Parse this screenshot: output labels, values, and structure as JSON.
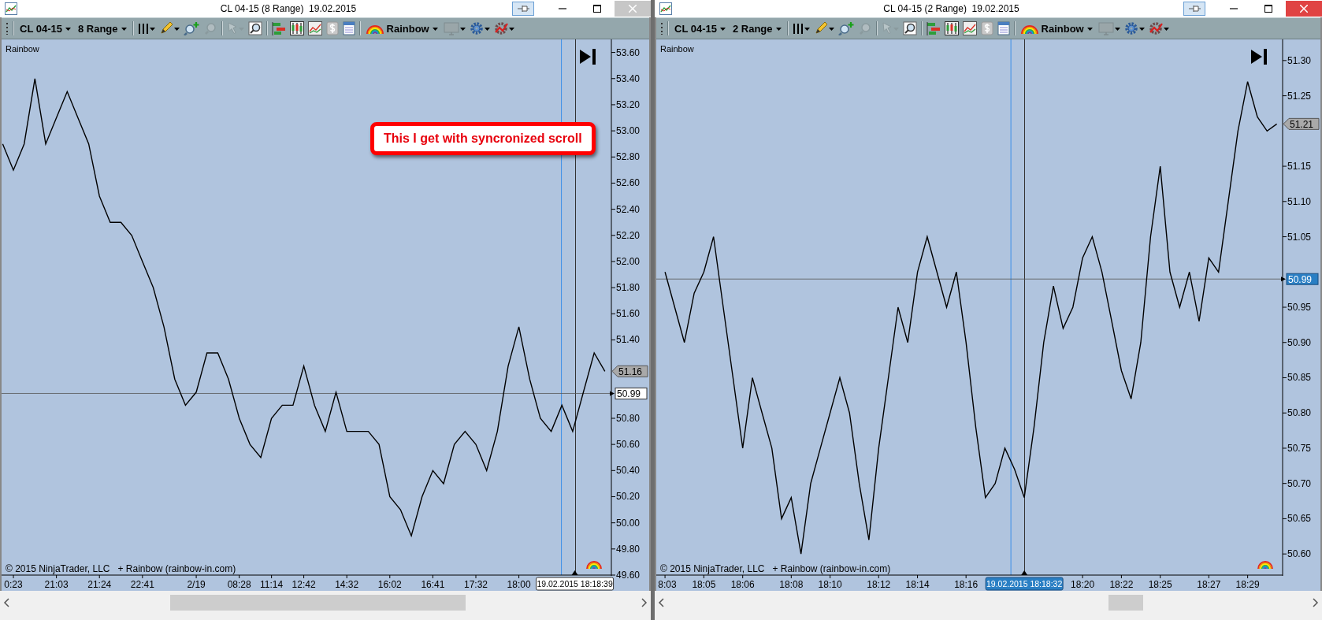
{
  "windows": [
    {
      "title": "CL 04-15 (8 Range)  19.02.2015",
      "close_highlighted": false,
      "toolbar": {
        "instrument": "CL 04-15",
        "period": "8 Range",
        "indicator": "Rainbow"
      },
      "chart": {
        "label": "Rainbow",
        "copyright": "© 2015 NinjaTrader, LLC   + Rainbow (rainbow-in.com)",
        "last_price": "51.16",
        "crosshair_price": "50.99",
        "cursor_time": "19.02.2015 18:18:39",
        "cursor_highlighted": false,
        "chart_data": {
          "type": "line",
          "ylim": [
            49.6,
            53.7
          ],
          "ref_lines": [
            {
              "axis": "y",
              "value": 50.99
            }
          ],
          "categories": [
            null,
            "0:23",
            null,
            null,
            null,
            "21:03",
            null,
            null,
            null,
            "21:24",
            null,
            null,
            null,
            "22:41",
            null,
            null,
            null,
            null,
            "2/19",
            null,
            null,
            null,
            "08:28",
            null,
            null,
            "11:14",
            null,
            null,
            "12:42",
            null,
            null,
            null,
            "14:32",
            null,
            null,
            null,
            "16:02",
            null,
            null,
            null,
            "16:41",
            null,
            null,
            null,
            "17:32",
            null,
            null,
            null,
            "18:00",
            null,
            null,
            null,
            null,
            null,
            null,
            null,
            null
          ],
          "yticks": [
            {
              "value": 53.6,
              "label": "53.60"
            },
            {
              "value": 53.4,
              "label": "53.40"
            },
            {
              "value": 53.2,
              "label": "53.20"
            },
            {
              "value": 53.0,
              "label": "53.00"
            },
            {
              "value": 52.8,
              "label": "52.80"
            },
            {
              "value": 52.6,
              "label": "52.60"
            },
            {
              "value": 52.4,
              "label": "52.40"
            },
            {
              "value": 52.2,
              "label": "52.20"
            },
            {
              "value": 52.0,
              "label": "52.00"
            },
            {
              "value": 51.8,
              "label": "51.80"
            },
            {
              "value": 51.6,
              "label": "51.60"
            },
            {
              "value": 51.4,
              "label": "51.40"
            },
            {
              "value": 50.8,
              "label": "50.80"
            },
            {
              "value": 50.6,
              "label": "50.60"
            },
            {
              "value": 50.4,
              "label": "50.40"
            },
            {
              "value": 50.2,
              "label": "50.20"
            },
            {
              "value": 50.0,
              "label": "50.00"
            },
            {
              "value": 49.8,
              "label": "49.80"
            },
            {
              "value": 49.6,
              "label": "49.60"
            }
          ],
          "series": [
            {
              "color": "#000000",
              "values": [
                52.9,
                52.7,
                52.9,
                53.4,
                52.9,
                53.1,
                53.3,
                53.1,
                52.9,
                52.5,
                52.3,
                52.3,
                52.2,
                52.0,
                51.8,
                51.5,
                51.1,
                50.9,
                51.0,
                51.3,
                51.3,
                51.1,
                50.8,
                50.6,
                50.5,
                50.8,
                50.9,
                50.9,
                51.2,
                50.9,
                50.7,
                51.0,
                50.7,
                50.7,
                50.7,
                50.6,
                50.2,
                50.1,
                49.9,
                50.2,
                50.4,
                50.3,
                50.6,
                50.7,
                50.6,
                50.4,
                50.7,
                51.2,
                51.5,
                51.1,
                50.8,
                50.7,
                50.9,
                50.7,
                51.0,
                51.3,
                51.16
              ]
            }
          ]
        }
      },
      "callout": "This I get with syncronized scroll"
    },
    {
      "title": "CL 04-15 (2 Range)  19.02.2015",
      "close_highlighted": true,
      "toolbar": {
        "instrument": "CL 04-15",
        "period": "2 Range",
        "indicator": "Rainbow"
      },
      "chart": {
        "label": "Rainbow",
        "copyright": "© 2015 NinjaTrader, LLC   + Rainbow (rainbow-in.com)",
        "last_price": "51.21",
        "crosshair_price": "50.99",
        "cursor_time": "19.02.2015 18:18:32",
        "cursor_highlighted": true,
        "chart_data": {
          "type": "line",
          "ylim": [
            50.57,
            51.33
          ],
          "ref_lines": [
            {
              "axis": "y",
              "value": 50.99
            }
          ],
          "categories": [
            "8:03",
            null,
            null,
            null,
            "18:05",
            null,
            null,
            null,
            "18:06",
            null,
            null,
            null,
            null,
            "18:08",
            null,
            null,
            null,
            "18:10",
            null,
            null,
            null,
            null,
            "18:12",
            null,
            null,
            null,
            "18:14",
            null,
            null,
            null,
            null,
            "18:16",
            null,
            null,
            null,
            null,
            null,
            null,
            null,
            null,
            null,
            null,
            null,
            "18:20",
            null,
            null,
            null,
            "18:22",
            null,
            null,
            null,
            "18:25",
            null,
            null,
            null,
            null,
            "18:27",
            null,
            null,
            null,
            "18:29",
            null,
            null,
            null
          ],
          "yticks": [
            {
              "value": 51.3,
              "label": "51.30"
            },
            {
              "value": 51.25,
              "label": "51.25"
            },
            {
              "value": 51.15,
              "label": "51.15"
            },
            {
              "value": 51.1,
              "label": "51.10"
            },
            {
              "value": 51.05,
              "label": "51.05"
            },
            {
              "value": 50.95,
              "label": "50.95"
            },
            {
              "value": 50.9,
              "label": "50.90"
            },
            {
              "value": 50.85,
              "label": "50.85"
            },
            {
              "value": 50.8,
              "label": "50.80"
            },
            {
              "value": 50.75,
              "label": "50.75"
            },
            {
              "value": 50.7,
              "label": "50.70"
            },
            {
              "value": 50.65,
              "label": "50.65"
            },
            {
              "value": 50.6,
              "label": "50.60"
            }
          ],
          "series": [
            {
              "color": "#000000",
              "values": [
                51.0,
                50.95,
                50.9,
                50.97,
                51.0,
                51.05,
                50.95,
                50.85,
                50.75,
                50.85,
                50.8,
                50.75,
                50.65,
                50.68,
                50.6,
                50.7,
                50.75,
                50.8,
                50.85,
                50.8,
                50.7,
                50.62,
                50.75,
                50.85,
                50.95,
                50.9,
                51.0,
                51.05,
                51.0,
                50.95,
                51.0,
                50.9,
                50.78,
                50.68,
                50.7,
                50.75,
                50.72,
                50.68,
                50.78,
                50.9,
                50.98,
                50.92,
                50.95,
                51.02,
                51.05,
                51.0,
                50.93,
                50.86,
                50.82,
                50.9,
                51.05,
                51.15,
                51.0,
                50.95,
                51.0,
                50.93,
                51.02,
                51.0,
                51.1,
                51.2,
                51.27,
                51.22,
                51.2,
                51.21
              ]
            }
          ]
        }
      }
    }
  ]
}
